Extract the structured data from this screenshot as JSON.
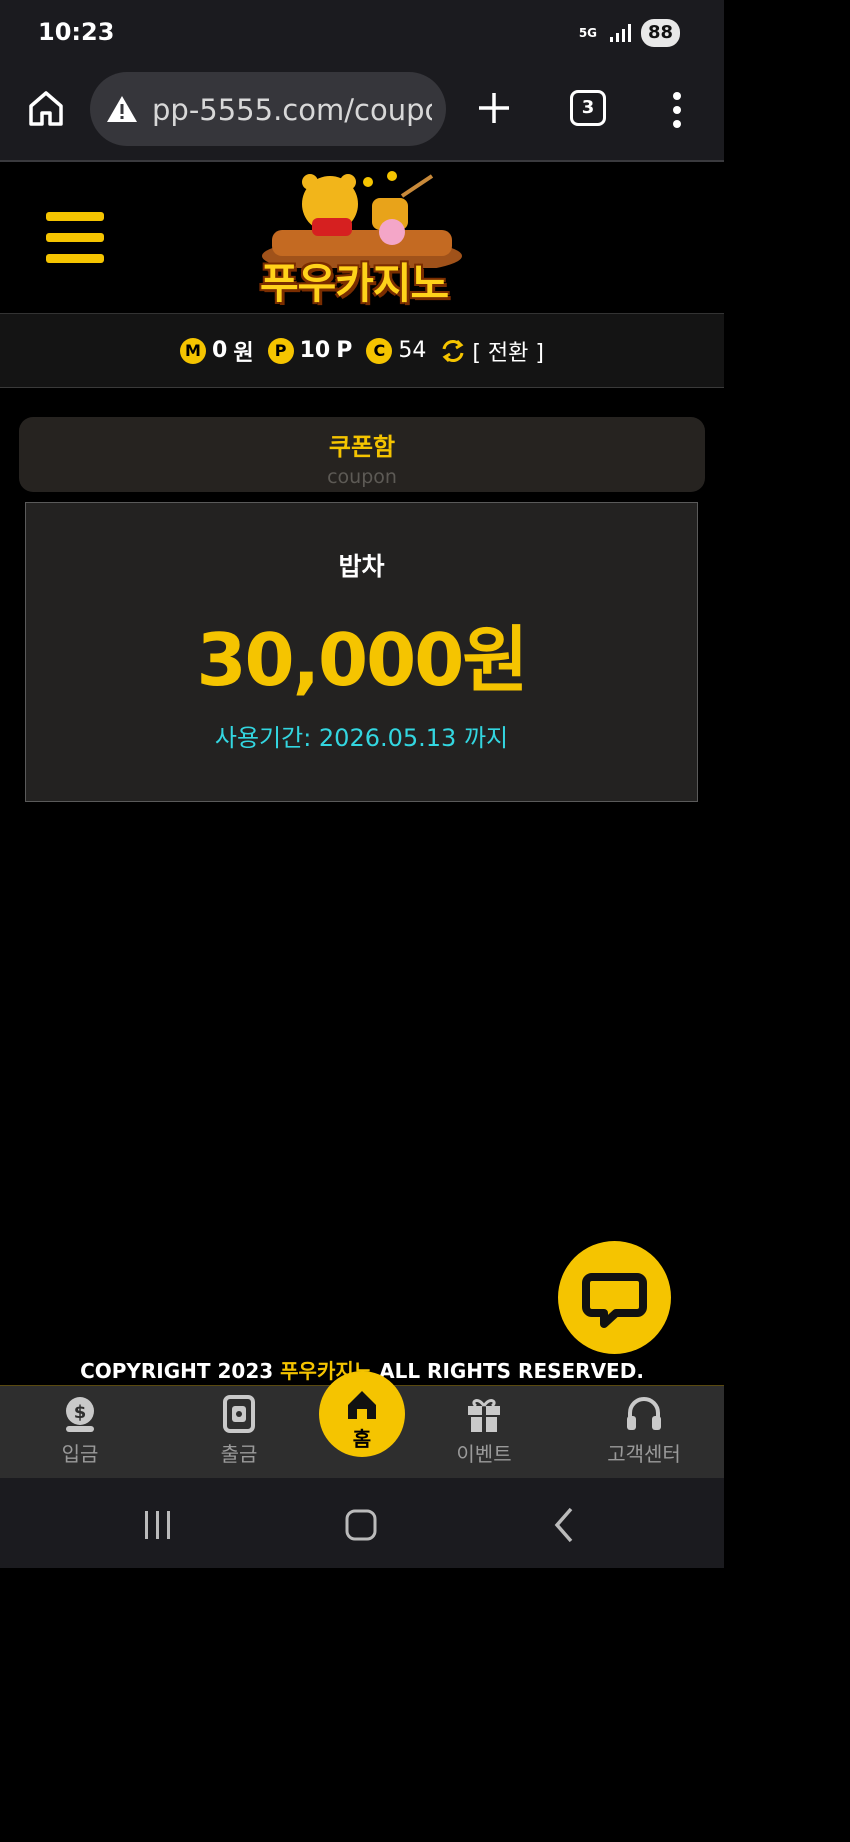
{
  "status_bar": {
    "time": "10:23",
    "network": "5G",
    "battery": "88"
  },
  "browser": {
    "url": "pp-5555.com/coupo",
    "tab_count": "3"
  },
  "header": {
    "logo_text": "푸우카지노"
  },
  "balance": {
    "money_icon": "M",
    "money_value": "0",
    "money_unit": "원",
    "point_icon": "P",
    "point_value": "10",
    "point_unit": "P",
    "coin_icon": "C",
    "coin_value": "54",
    "convert_label": "[ 전환 ]"
  },
  "coupon_box": {
    "title": "쿠폰함",
    "subtitle": "coupon"
  },
  "coupon": {
    "name": "밥차",
    "amount": "30,000원",
    "expiry": "사용기간: 2026.05.13 까지"
  },
  "footer": {
    "copyright_prefix": "COPYRIGHT 2023",
    "brand": "푸우카지노",
    "copyright_suffix": "ALL RIGHTS RESERVED."
  },
  "bottom_nav": {
    "deposit": "입금",
    "withdraw": "출금",
    "home": "홈",
    "event": "이벤트",
    "support": "고객센터"
  },
  "colors": {
    "accent": "#f5c400",
    "expiry": "#33d6e0",
    "card": "#232221"
  }
}
